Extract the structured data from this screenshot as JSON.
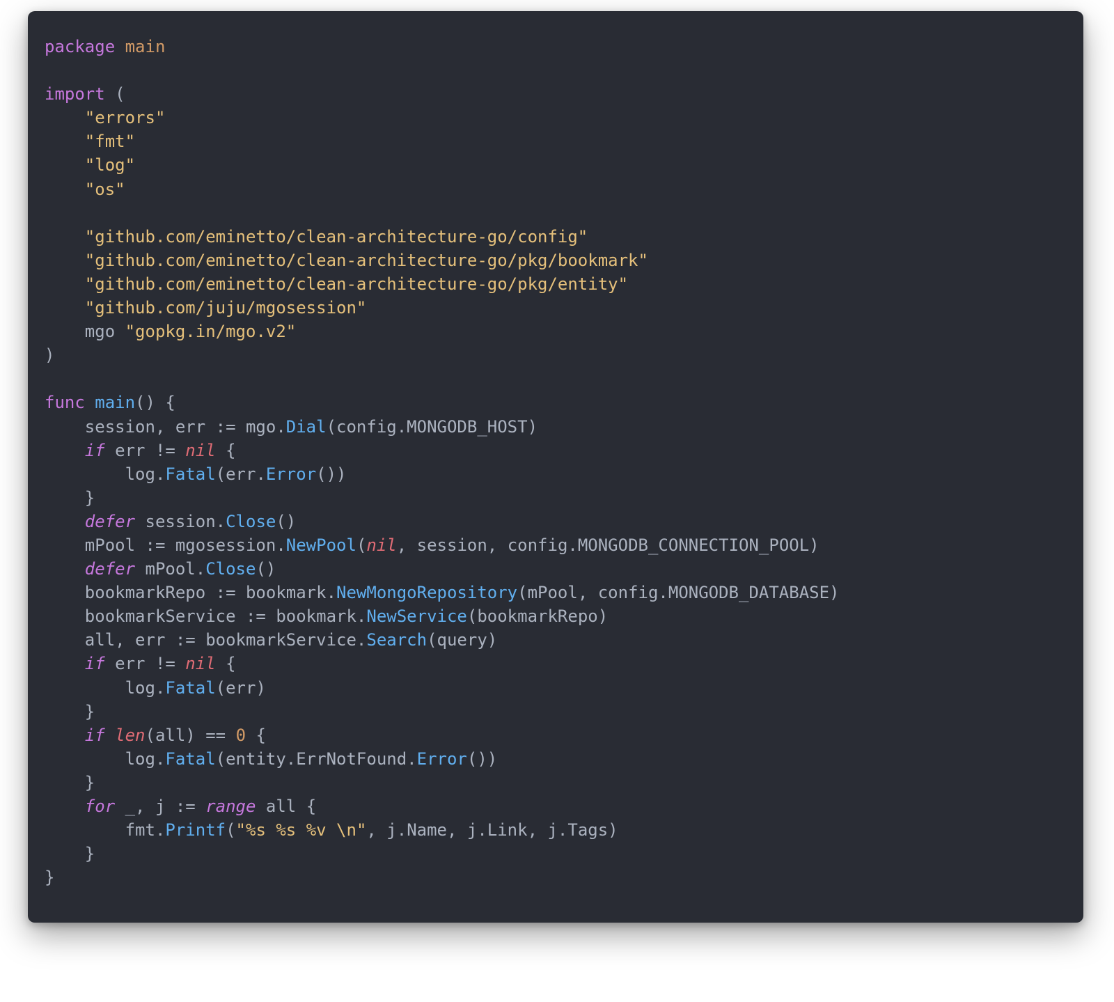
{
  "language": "go",
  "theme": "one-dark-like",
  "background": "#292c34",
  "foreground": "#abb2bf",
  "colors": {
    "keyword": "#c678dd",
    "string": "#e5c07b",
    "func": "#61afef",
    "const": "#d19a66",
    "builtin": "#e06c75"
  },
  "code": {
    "package_kw": "package",
    "package_name": "main",
    "import_kw": "import",
    "lparen": "(",
    "rparen": ")",
    "imports_std": [
      "\"errors\"",
      "\"fmt\"",
      "\"log\"",
      "\"os\""
    ],
    "imports_ext": [
      "\"github.com/eminetto/clean-architecture-go/config\"",
      "\"github.com/eminetto/clean-architecture-go/pkg/bookmark\"",
      "\"github.com/eminetto/clean-architecture-go/pkg/entity\"",
      "\"github.com/juju/mgosession\""
    ],
    "import_alias_id": "mgo",
    "import_alias_path": "\"gopkg.in/mgo.v2\"",
    "func_kw": "func",
    "func_name": "main",
    "func_sig_tail": "() {",
    "l_session": "    session, err := mgo.",
    "l_session_fn": "Dial",
    "l_session_tail": "(config.MONGODB_HOST)",
    "if_kw": "if",
    "l_if1_cond_a": " err != ",
    "nil_kw": "nil",
    "l_if1_cond_b": " {",
    "l_logfatal_pre": "        log.",
    "l_fatal": "Fatal",
    "l_logfatal1_tail": "(err.",
    "l_error_fn": "Error",
    "l_logfatal1_tail2": "())",
    "rbrace4": "    }",
    "defer_kw": "defer",
    "l_defer1_mid": " session.",
    "close_fn": "Close",
    "l_defer1_tail": "()",
    "l_mpool_pre": "    mPool := mgosession.",
    "newpool_fn": "NewPool",
    "l_mpool_mid": "(",
    "l_mpool_tail": ", session, config.MONGODB_CONNECTION_POOL)",
    "l_defer2_mid": " mPool.",
    "l_repo_pre": "    bookmarkRepo := bookmark.",
    "newmongo_fn": "NewMongoRepository",
    "l_repo_tail": "(mPool, config.MONGODB_DATABASE)",
    "l_svc_pre": "    bookmarkService := bookmark.",
    "newservice_fn": "NewService",
    "l_svc_tail": "(bookmarkRepo)",
    "l_all_pre": "    all, err := bookmarkService.",
    "search_fn": "Search",
    "l_all_tail": "(query)",
    "l_logfatal2_tail": "(err)",
    "len_kw": "len",
    "l_iflen_pre": " ",
    "l_iflen_mid": "(all) == ",
    "zero": "0",
    "l_iflen_tail": " {",
    "l_logfatal3_mid": "(entity.ErrNotFound.",
    "l_logfatal3_tail": "())",
    "for_kw": "for",
    "range_kw": "range",
    "l_for_mid_a": " _, j := ",
    "l_for_mid_b": " all {",
    "l_printf_pre": "        fmt.",
    "printf_fn": "Printf",
    "l_printf_open": "(",
    "printf_fmt": "\"%s %s %v \\n\"",
    "l_printf_tail": ", j.Name, j.Link, j.Tags)",
    "rbrace0": "}"
  }
}
